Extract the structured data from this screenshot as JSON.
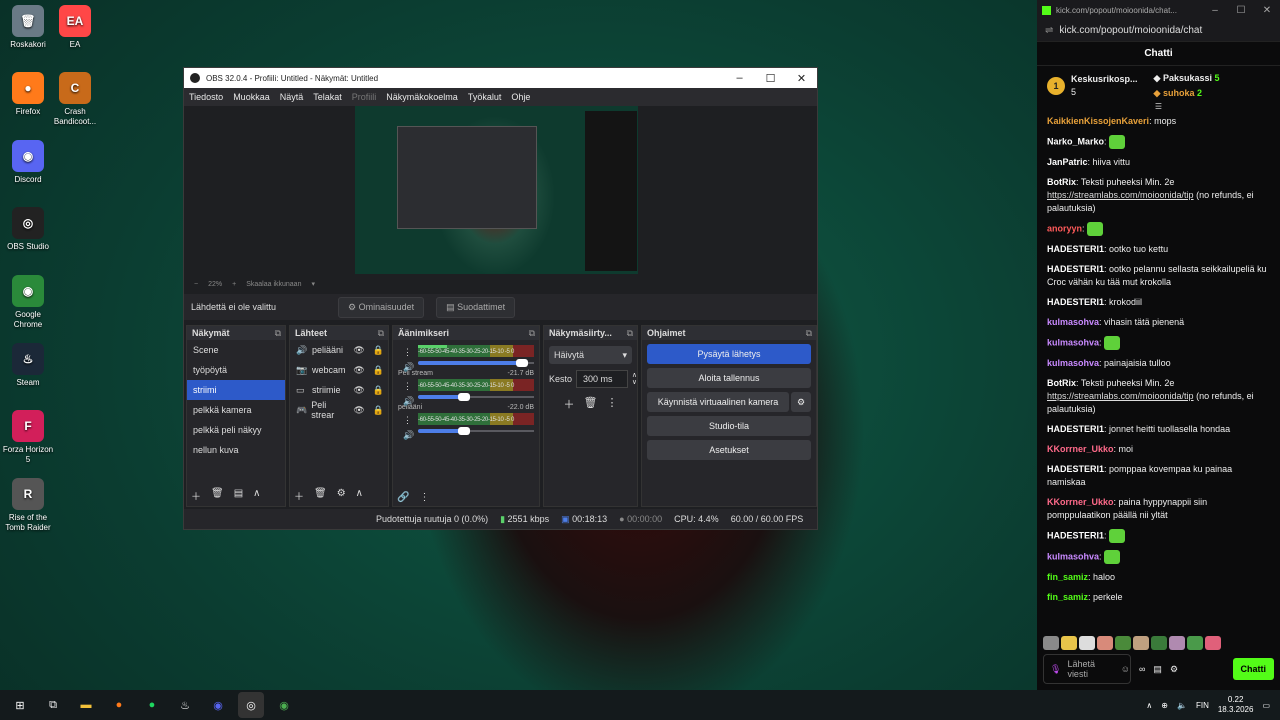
{
  "desktop": {
    "icons": [
      {
        "label": "Roskakori",
        "glyph": "🗑",
        "color": "#6a7a86"
      },
      {
        "label": "EA",
        "glyph": "EA",
        "color": "#ff4747"
      },
      {
        "label": "Firefox",
        "glyph": "●",
        "color": "#ff7a1a"
      },
      {
        "label": "Crash Bandicoot...",
        "glyph": "C",
        "color": "#c86a1a"
      },
      {
        "label": "Discord",
        "glyph": "◉",
        "color": "#5865f2"
      },
      {
        "label": "OBS Studio",
        "glyph": "◎",
        "color": "#222"
      },
      {
        "label": "Google Chrome",
        "glyph": "◉",
        "color": "#2a8a3a"
      },
      {
        "label": "Steam",
        "glyph": "♨",
        "color": "#1b2838"
      },
      {
        "label": "Forza Horizon 5",
        "glyph": "F",
        "color": "#d21f5a"
      },
      {
        "label": "Rise of the Tomb Raider",
        "glyph": "R",
        "color": "#555"
      }
    ]
  },
  "obs": {
    "title": "OBS 32.0.4 - Profiili: Untitled - Näkymät: Untitled",
    "menu": [
      "Tiedosto",
      "Muokkaa",
      "Näytä",
      "Telakat",
      "Profiili",
      "Näkymäkokoelma",
      "Työkalut",
      "Ohje"
    ],
    "zoom": "22%",
    "fit_label": "Skaalaa ikkunaan",
    "no_source": "Lähdettä ei ole valittu",
    "properties": "Ominaisuudet",
    "filters": "Suodattimet",
    "scenes_title": "Näkymät",
    "scenes": [
      "Scene",
      "työpöytä",
      "striimi",
      "pelkkä kamera",
      "pelkkä peli näkyy",
      "nellun kuva"
    ],
    "sources_title": "Lähteet",
    "sources": [
      {
        "name": "peliääni",
        "icon": "🔊"
      },
      {
        "name": "webcam",
        "icon": "📷"
      },
      {
        "name": "striimie",
        "icon": "▭"
      },
      {
        "name": "Peli strear",
        "icon": "🎮"
      }
    ],
    "mixer_title": "Äänimikseri",
    "meter_scale": "-60-55-50-45-40-35-30-25-20-15-10 -5 0",
    "mixer": [
      {
        "name": "",
        "db": "",
        "level": 0.25,
        "vol": 0.95
      },
      {
        "name": "Peli stream",
        "db": "-21.7 dB",
        "level": 0.0,
        "vol": 0.45
      },
      {
        "name": "peliääni",
        "db": "-22.0 dB",
        "level": 0.0,
        "vol": 0.45
      }
    ],
    "transitions_title": "Näkymäsiirty...",
    "transition": "Häivytä",
    "duration_label": "Kesto",
    "duration": "300 ms",
    "controls_title": "Ohjaimet",
    "controls": [
      "Pysäytä lähetys",
      "Aloita tallennus",
      "Käynnistä virtuaalinen kamera",
      "Studio-tila",
      "Asetukset"
    ],
    "status": {
      "dropped": "Pudotettuja ruutuja 0 (0.0%)",
      "bitrate": "2551 kbps",
      "stream_time": "00:18:13",
      "rec_time": "00:00:00",
      "cpu": "CPU: 4.4%",
      "fps": "60.00 / 60.00 FPS"
    }
  },
  "chat": {
    "tab_title": "kick.com/popout/moioonida/chat...",
    "url": "kick.com/popout/moioonida/chat",
    "header": "Chatti",
    "leaders": [
      {
        "name": "Keskusrikosp...",
        "count": "5"
      },
      {
        "name": "Paksukassi",
        "count": "5"
      },
      {
        "name": "suhoka",
        "count": "2"
      }
    ],
    "messages": [
      {
        "user": "KaikkienKissojenKaveri",
        "color": "#e8a13a",
        "text": "mops"
      },
      {
        "user": "Narko_Marko",
        "color": "#ffffff",
        "text": ""
      },
      {
        "user": "JanPatric",
        "color": "#ffffff",
        "text": "hiiva vittu"
      },
      {
        "user": "BotRix",
        "color": "#ffffff",
        "text": "Teksti puheeksi Min. 2e",
        "link": "https://streamlabs.com/moioonida/tip",
        "tail": "(no refunds, ei palautuksia)"
      },
      {
        "user": "anoryyn",
        "color": "#ff5a5a",
        "text": ""
      },
      {
        "user": "HADESTERI1",
        "color": "#ffffff",
        "text": "ootko tuo kettu"
      },
      {
        "user": "HADESTERI1",
        "color": "#ffffff",
        "text": "ootko pelannu sellasta seikkailupeliä ku Croc vähän ku tää mut krokolla"
      },
      {
        "user": "HADESTERI1",
        "color": "#ffffff",
        "text": "krokodiil"
      },
      {
        "user": "kulmasohva",
        "color": "#c98aff",
        "text": "vihasin tätä pienenä"
      },
      {
        "user": "kulmasohva",
        "color": "#c98aff",
        "text": ""
      },
      {
        "user": "kulmasohva",
        "color": "#c98aff",
        "text": "painajaisia tulloo"
      },
      {
        "user": "BotRix",
        "color": "#ffffff",
        "text": "Teksti puheeksi Min. 2e",
        "link": "https://streamlabs.com/moioonida/tip",
        "tail": "(no refunds, ei palautuksia)"
      },
      {
        "user": "HADESTERI1",
        "color": "#ffffff",
        "text": "jonnet heitti tuollasella hondaa"
      },
      {
        "user": "KKorrner_Ukko",
        "color": "#ff6a8a",
        "text": "moi"
      },
      {
        "user": "HADESTERI1",
        "color": "#ffffff",
        "text": "pomppaa kovempaa ku painaa namiskaa"
      },
      {
        "user": "KKorrner_Ukko",
        "color": "#ff6a8a",
        "text": "paina hyppynappii siin pomppulaatikon päällä nii yltät"
      },
      {
        "user": "HADESTERI1",
        "color": "#ffffff",
        "text": ""
      },
      {
        "user": "kulmasohva",
        "color": "#c98aff",
        "text": ""
      },
      {
        "user": "fin_samiz",
        "color": "#53fc18",
        "text": "haloo"
      },
      {
        "user": "fin_samiz",
        "color": "#53fc18",
        "text": "perkele"
      }
    ],
    "input_placeholder": "Lähetä viesti",
    "send": "Chatti"
  },
  "taskbar": {
    "lang": "FIN",
    "time": "0.22",
    "date": "18.3.2026"
  }
}
